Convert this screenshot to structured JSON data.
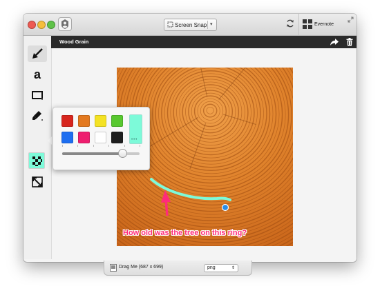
{
  "window": {
    "toolbar": {
      "capture_mode": "Screen Snap",
      "service_label": "Evernote"
    },
    "document": {
      "title": "Wood Grain"
    },
    "tools": [
      "arrow-tool",
      "text-tool",
      "rectangle-tool",
      "highlighter-tool",
      "color-tool",
      "pixelate-tool",
      "crop-tool"
    ],
    "color_picker": {
      "swatches": [
        "#d7261e",
        "#e3791f",
        "#f4e224",
        "#58c82f",
        "#1e6ef0",
        "#ee1e6f",
        "#ffffff",
        "#1e1e1e"
      ],
      "selected": "#7dfad9",
      "size_ticks": 6,
      "size_level": 0.78
    },
    "canvas": {
      "annotation_text": "How old was the tree on this ring?",
      "annotation_color": "#ff2b7a",
      "highlight_color": "#7dfad9"
    },
    "footer": {
      "drag_label": "Drag Me (687 x 699)",
      "format": "png"
    }
  }
}
